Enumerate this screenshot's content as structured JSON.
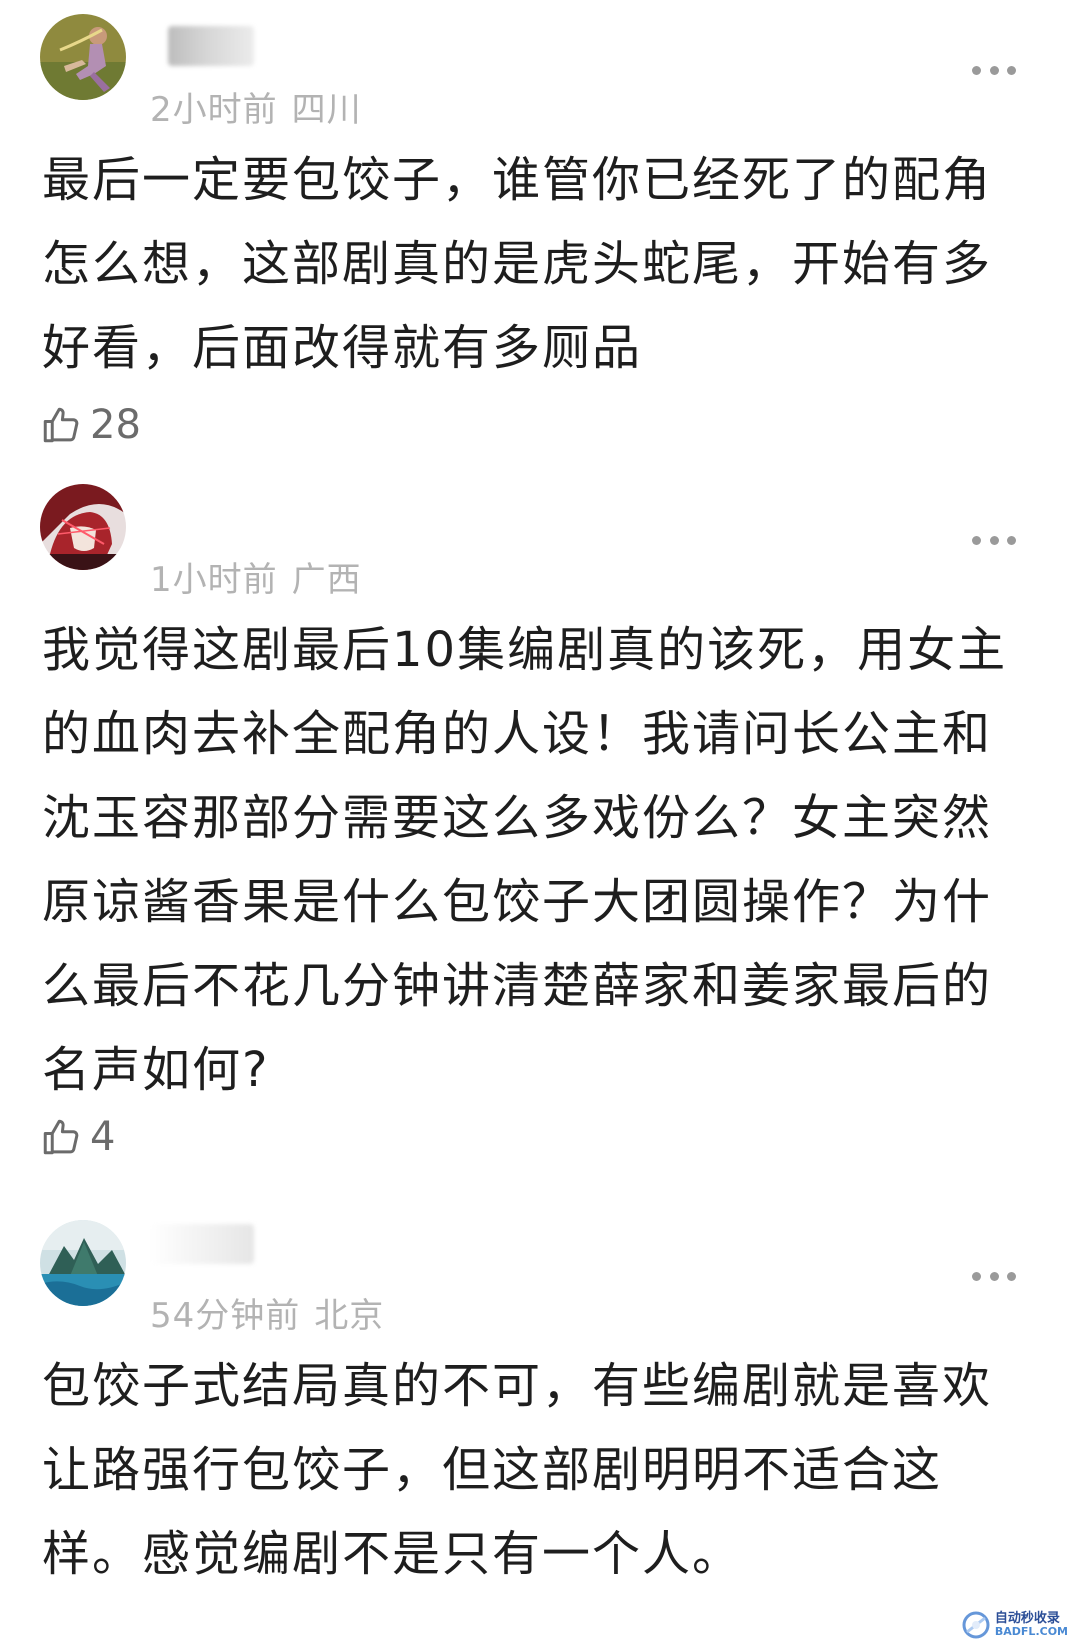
{
  "comments": [
    {
      "time": "2小时前",
      "location": "四川",
      "text": "最后一定要包饺子，谁管你已经死了的配角怎么想，这部剧真的是虎头蛇尾，开始有多好看，后面改得就有多厕品",
      "likes": "28",
      "avatar_icon": "avatar-running-figure"
    },
    {
      "time": "1小时前",
      "location": "广西",
      "text": "我觉得这剧最后10集编剧真的该死，用女主的血肉去补全配角的人设！我请问长公主和沈玉容那部分需要这么多戏份么？女主突然原谅酱香果是什么包饺子大团圆操作？为什么最后不花几分钟讲清楚薛家和姜家最后的名声如何?",
      "likes": "4",
      "avatar_icon": "avatar-red-hair-anime"
    },
    {
      "time": "54分钟前",
      "location": "北京",
      "text": "包饺子式结局真的不可，有些编剧就是喜欢让路强行包饺子，但这部剧明明不适合这样。感觉编剧不是只有一个人。",
      "likes": "",
      "avatar_icon": "avatar-island-landscape"
    }
  ],
  "watermark": {
    "line1": "自动秒收录",
    "line2": "BADFL.COM"
  },
  "icons": {
    "like": "thumbs-up-icon",
    "more": "more-dots-icon"
  },
  "colors": {
    "meta": "#b3b3b3",
    "text": "#1e1e1e",
    "like": "#6b6b6b"
  }
}
